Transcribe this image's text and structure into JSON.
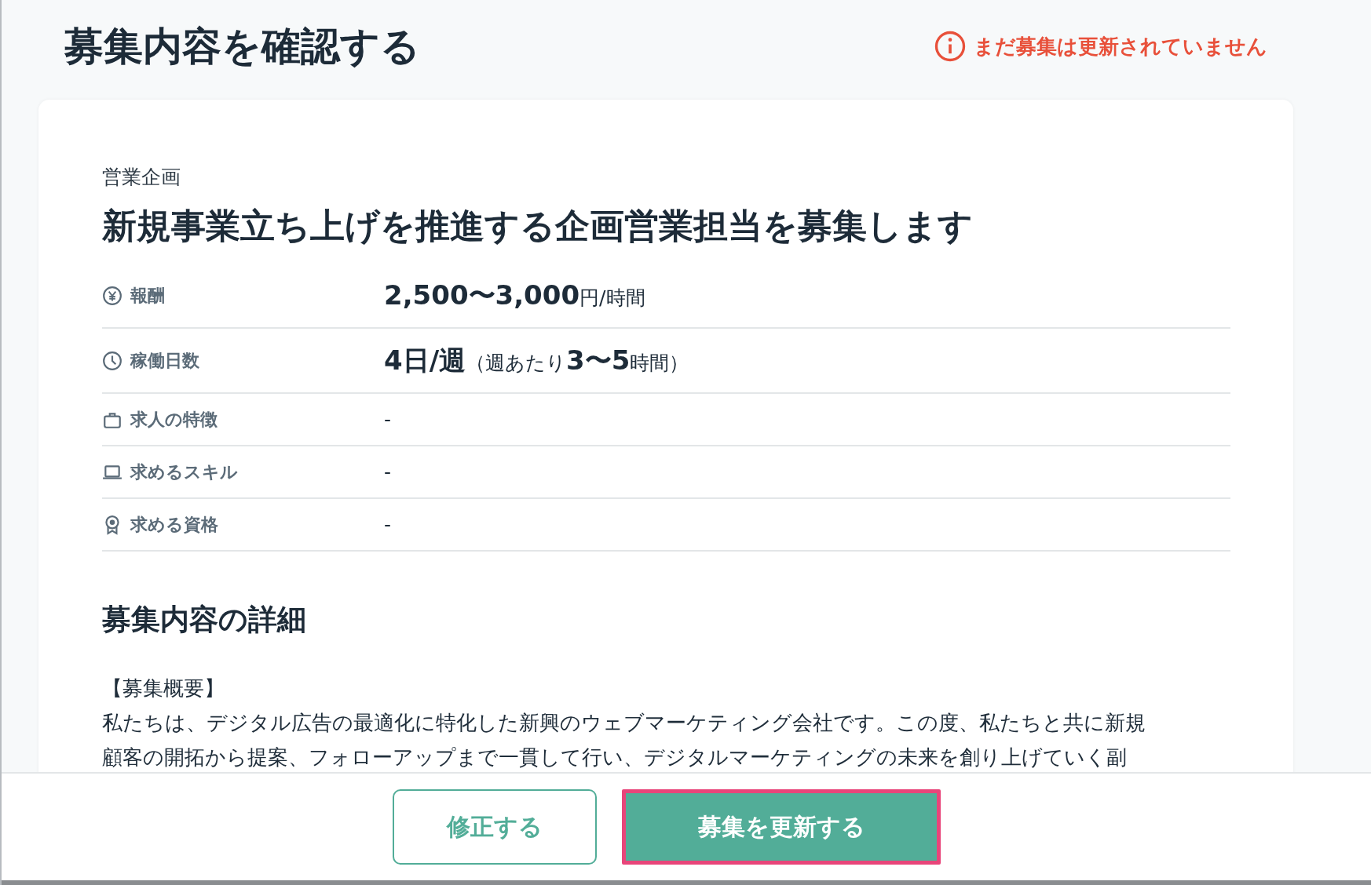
{
  "page_title": "募集内容を確認する",
  "notice": {
    "text": "まだ募集は更新されていません"
  },
  "job": {
    "category": "営業企画",
    "title": "新規事業立ち上げを推進する企画営業担当を募集します",
    "attributes": [
      {
        "label": "報酬",
        "value": "**2,500〜3,000**円/時間"
      },
      {
        "label": "稼働日数",
        "value": "**4日/週**（週あたり**3〜5**時間）"
      },
      {
        "label": "求人の特徴",
        "value": "-"
      },
      {
        "label": "求めるスキル",
        "value": "-"
      },
      {
        "label": "求める資格",
        "value": "-"
      }
    ],
    "details": {
      "heading": "募集内容の詳細",
      "subheading": "【募集概要】",
      "lines": [
        "私たちは、デジタル広告の最適化に特化した新興のウェブマーケティング会社です。この度、私たちと共に新規",
        "顧客の開拓から提案、フォローアップまで一貫して行い、デジタルマーケティングの未来を創り上げていく副"
      ]
    }
  },
  "buttons": [
    {
      "label": "修正する",
      "kind": "outline",
      "focused": false
    },
    {
      "label": "募集を更新する",
      "kind": "primary",
      "focused": true
    }
  ]
}
